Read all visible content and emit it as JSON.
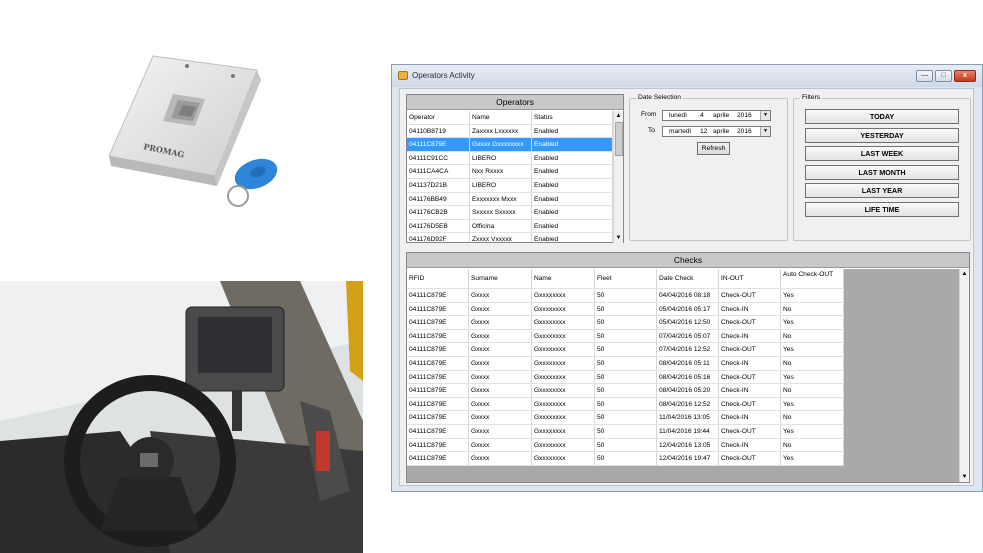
{
  "window": {
    "title": "Operators Activity",
    "controls": {
      "minimize": "—",
      "maximize": "□",
      "close": "x"
    }
  },
  "reader_photo": {
    "brand": "PROMAG"
  },
  "operators": {
    "title": "Operators",
    "columns": [
      "Operator",
      "Name",
      "Status"
    ],
    "rows": [
      [
        "04110B8719",
        "Zaxxxx Lxxxxxx",
        "Enabled"
      ],
      [
        "04111C879E",
        "Gxxxx Gxxxxxxxx",
        "Enabled"
      ],
      [
        "04111C91CC",
        "LIBERO",
        "Enabled"
      ],
      [
        "04111CA4CA",
        "Nxx Rxxxx",
        "Enabled"
      ],
      [
        "041137D21B",
        "LIBERO",
        "Enabled"
      ],
      [
        "041176BB49",
        "Exxxxxxx Mxxx",
        "Enabled"
      ],
      [
        "041176CB2B",
        "Sxxxxx Sxxxxx",
        "Enabled"
      ],
      [
        "041176D5EB",
        "Officina",
        "Enabled"
      ],
      [
        "041176D92F",
        "Zxxxx Vxxxxx",
        "Enabled"
      ]
    ],
    "selected_index": 1
  },
  "date_selection": {
    "title": "Date Selection",
    "from_label": "From",
    "to_label": "To",
    "from": {
      "weekday": "lunedì",
      "day": "4",
      "month": "aprile",
      "year": "2016"
    },
    "to": {
      "weekday": "martedì",
      "day": "12",
      "month": "aprile",
      "year": "2016"
    },
    "refresh_label": "Refresh",
    "dropdown_glyph": "▼"
  },
  "filters": {
    "title": "Filters",
    "buttons": [
      "TODAY",
      "YESTERDAY",
      "LAST WEEK",
      "LAST MONTH",
      "LAST YEAR",
      "LIFE TIME"
    ]
  },
  "checks": {
    "title": "Checks",
    "columns": [
      "RFID",
      "Surname",
      "Name",
      "Fleet",
      "Date Check",
      "IN-OUT",
      "Auto Check-OUT"
    ],
    "rows": [
      [
        "04111C879E",
        "Gxxxx",
        "Gxxxxxxxx",
        "50",
        "04/04/2016 08:18",
        "Check-OUT",
        "Yes"
      ],
      [
        "04111C879E",
        "Gxxxx",
        "Gxxxxxxxx",
        "50",
        "05/04/2016 05:17",
        "Check-IN",
        "No"
      ],
      [
        "04111C879E",
        "Gxxxx",
        "Gxxxxxxxx",
        "50",
        "05/04/2016 12:50",
        "Check-OUT",
        "Yes"
      ],
      [
        "04111C879E",
        "Gxxxx",
        "Gxxxxxxxx",
        "50",
        "07/04/2016 05:07",
        "Check-IN",
        "No"
      ],
      [
        "04111C879E",
        "Gxxxx",
        "Gxxxxxxxx",
        "50",
        "07/04/2016 12:52",
        "Check-OUT",
        "Yes"
      ],
      [
        "04111C879E",
        "Gxxxx",
        "Gxxxxxxxx",
        "50",
        "08/04/2016 05:11",
        "Check-IN",
        "No"
      ],
      [
        "04111C879E",
        "Gxxxx",
        "Gxxxxxxxx",
        "50",
        "08/04/2016 05:16",
        "Check-OUT",
        "Yes"
      ],
      [
        "04111C879E",
        "Gxxxx",
        "Gxxxxxxxx",
        "50",
        "08/04/2016 05:20",
        "Check-IN",
        "No"
      ],
      [
        "04111C879E",
        "Gxxxx",
        "Gxxxxxxxx",
        "50",
        "08/04/2016 12:52",
        "Check-OUT",
        "Yes"
      ],
      [
        "04111C879E",
        "Gxxxx",
        "Gxxxxxxxx",
        "50",
        "11/04/2016 13:05",
        "Check-IN",
        "No"
      ],
      [
        "04111C879E",
        "Gxxxx",
        "Gxxxxxxxx",
        "50",
        "11/04/2016 19:44",
        "Check-OUT",
        "Yes"
      ],
      [
        "04111C879E",
        "Gxxxx",
        "Gxxxxxxxx",
        "50",
        "12/04/2016 13:05",
        "Check-IN",
        "No"
      ],
      [
        "04111C879E",
        "Gxxxx",
        "Gxxxxxxxx",
        "50",
        "12/04/2016 19:47",
        "Check-OUT",
        "Yes"
      ]
    ]
  },
  "scroll": {
    "up": "▲",
    "down": "▼"
  },
  "colors": {
    "selection": "#3399ff",
    "header_bg": "#c8c8c8",
    "empty_grid_bg": "#a9a9a9"
  }
}
